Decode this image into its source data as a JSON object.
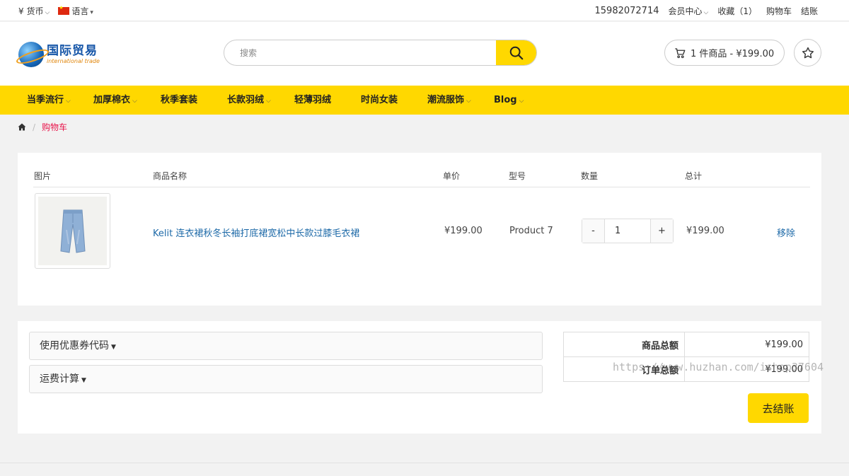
{
  "topbar": {
    "currency_symbol": "¥",
    "currency_label": "货币",
    "language_label": "语言",
    "phone": "15982072714",
    "member_center": "会员中心",
    "favorites": "收藏（1）",
    "cart": "购物车",
    "checkout": "结账"
  },
  "header": {
    "logo_cn": "国际贸易",
    "logo_en": "international trade",
    "search_placeholder": "搜索",
    "cart_summary": "1 件商品 - ¥199.00"
  },
  "nav": {
    "items": [
      {
        "label": "当季流行",
        "has_dropdown": true
      },
      {
        "label": "加厚棉衣",
        "has_dropdown": true
      },
      {
        "label": "秋季套装",
        "has_dropdown": false
      },
      {
        "label": "长款羽绒",
        "has_dropdown": true
      },
      {
        "label": "轻薄羽绒",
        "has_dropdown": false
      },
      {
        "label": "时尚女装",
        "has_dropdown": false
      },
      {
        "label": "潮流服饰",
        "has_dropdown": true
      },
      {
        "label": "Blog",
        "has_dropdown": true
      }
    ]
  },
  "breadcrumb": {
    "sep": "/",
    "current": "购物车"
  },
  "cart_table": {
    "headers": {
      "image": "图片",
      "name": "商品名称",
      "unit_price": "单价",
      "model": "型号",
      "quantity": "数量",
      "total": "总计"
    },
    "row": {
      "name": "Kelit 连衣裙秋冬长袖打底裙宽松中长款过膝毛衣裙",
      "unit_price": "¥199.00",
      "model": "Product 7",
      "qty_minus": "-",
      "quantity": "1",
      "qty_plus": "+",
      "total": "¥199.00",
      "remove": "移除"
    }
  },
  "extras": {
    "coupon": "使用优惠券代码",
    "shipping": "运费计算"
  },
  "totals": {
    "subtotal_label": "商品总额",
    "subtotal_value": "¥199.00",
    "order_total_label": "订单总额",
    "order_total_value": "¥199.00",
    "checkout_button": "去结账"
  },
  "watermark": "https://www.huzhan.com/ishop37604",
  "colors": {
    "accent_yellow": "#ffd800",
    "link_blue": "#1e6aa8",
    "breadcrumb_red": "#e8154b"
  }
}
